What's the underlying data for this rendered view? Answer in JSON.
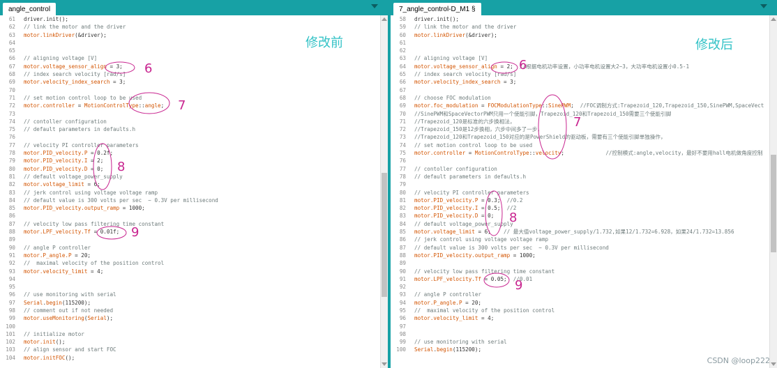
{
  "left": {
    "tab": "angle_control",
    "title": "修改前",
    "lines": [
      {
        "n": "61",
        "segs": [
          [
            "t",
            "driver.init();"
          ]
        ]
      },
      {
        "n": "62",
        "segs": [
          [
            "c",
            "// link the motor and the driver"
          ]
        ]
      },
      {
        "n": "63",
        "segs": [
          [
            "k",
            "motor.linkDriver"
          ],
          [
            "t",
            "(&driver);"
          ]
        ]
      },
      {
        "n": "64",
        "segs": []
      },
      {
        "n": "65",
        "segs": []
      },
      {
        "n": "66",
        "segs": [
          [
            "c",
            "// aligning voltage [V]"
          ]
        ]
      },
      {
        "n": "67",
        "segs": [
          [
            "k",
            "motor.voltage_sensor_align"
          ],
          [
            "t",
            " = 3;"
          ]
        ]
      },
      {
        "n": "68",
        "segs": [
          [
            "c",
            "// index search velocity [rad/s]"
          ]
        ]
      },
      {
        "n": "69",
        "segs": [
          [
            "k",
            "motor.velocity_index_search"
          ],
          [
            "t",
            " = 3;"
          ]
        ]
      },
      {
        "n": "70",
        "segs": []
      },
      {
        "n": "71",
        "segs": [
          [
            "c",
            "// set motion control loop to be used"
          ]
        ]
      },
      {
        "n": "72",
        "segs": [
          [
            "k",
            "motor.controller"
          ],
          [
            "t",
            " = "
          ],
          [
            "k",
            "MotionControlType"
          ],
          [
            "t",
            "::"
          ],
          [
            "k",
            "angle"
          ],
          [
            "t",
            ";"
          ]
        ]
      },
      {
        "n": "73",
        "segs": []
      },
      {
        "n": "74",
        "segs": [
          [
            "c",
            "// contoller configuration"
          ]
        ]
      },
      {
        "n": "75",
        "segs": [
          [
            "c",
            "// default parameters in defaults.h"
          ]
        ]
      },
      {
        "n": "76",
        "segs": []
      },
      {
        "n": "77",
        "segs": [
          [
            "c",
            "// velocity PI controller parameters"
          ]
        ]
      },
      {
        "n": "78",
        "segs": [
          [
            "k",
            "motor.PID_velocity.P"
          ],
          [
            "t",
            " = 0.2f;"
          ]
        ]
      },
      {
        "n": "79",
        "segs": [
          [
            "k",
            "motor.PID_velocity.I"
          ],
          [
            "t",
            " = 2;"
          ]
        ]
      },
      {
        "n": "80",
        "segs": [
          [
            "k",
            "motor.PID_velocity.D"
          ],
          [
            "t",
            " = 0;"
          ]
        ]
      },
      {
        "n": "81",
        "segs": [
          [
            "c",
            "// default voltage_power_supply"
          ]
        ]
      },
      {
        "n": "82",
        "segs": [
          [
            "k",
            "motor.voltage_limit"
          ],
          [
            "t",
            " = 6;"
          ]
        ]
      },
      {
        "n": "83",
        "segs": [
          [
            "c",
            "// jerk control using voltage voltage ramp"
          ]
        ]
      },
      {
        "n": "84",
        "segs": [
          [
            "c",
            "// default value is 300 volts per sec  ~ 0.3V per millisecond"
          ]
        ]
      },
      {
        "n": "85",
        "segs": [
          [
            "k",
            "motor.PID_velocity.output_ramp"
          ],
          [
            "t",
            " = 1000;"
          ]
        ]
      },
      {
        "n": "86",
        "segs": []
      },
      {
        "n": "87",
        "segs": [
          [
            "c",
            "// velocity low pass filtering time constant"
          ]
        ]
      },
      {
        "n": "88",
        "segs": [
          [
            "k",
            "motor.LPF_velocity.Tf"
          ],
          [
            "t",
            " = 0.01f;"
          ]
        ]
      },
      {
        "n": "89",
        "segs": []
      },
      {
        "n": "90",
        "segs": [
          [
            "c",
            "// angle P controller"
          ]
        ]
      },
      {
        "n": "91",
        "segs": [
          [
            "k",
            "motor.P_angle.P"
          ],
          [
            "t",
            " = 20;"
          ]
        ]
      },
      {
        "n": "92",
        "segs": [
          [
            "c",
            "//  maximal velocity of the position control"
          ]
        ]
      },
      {
        "n": "93",
        "segs": [
          [
            "k",
            "motor.velocity_limit"
          ],
          [
            "t",
            " = 4;"
          ]
        ]
      },
      {
        "n": "94",
        "segs": []
      },
      {
        "n": "95",
        "segs": []
      },
      {
        "n": "96",
        "segs": [
          [
            "c",
            "// use monitoring with serial"
          ]
        ]
      },
      {
        "n": "97",
        "segs": [
          [
            "k",
            "Serial"
          ],
          [
            "t",
            "."
          ],
          [
            "k",
            "begin"
          ],
          [
            "t",
            "(115200);"
          ]
        ]
      },
      {
        "n": "98",
        "segs": [
          [
            "c",
            "// comment out if not needed"
          ]
        ]
      },
      {
        "n": "99",
        "segs": [
          [
            "k",
            "motor.useMonitoring"
          ],
          [
            "t",
            "("
          ],
          [
            "k",
            "Serial"
          ],
          [
            "t",
            ");"
          ]
        ]
      },
      {
        "n": "100",
        "segs": []
      },
      {
        "n": "101",
        "segs": [
          [
            "c",
            "// initialize motor"
          ]
        ]
      },
      {
        "n": "102",
        "segs": [
          [
            "k",
            "motor.init"
          ],
          [
            "t",
            "();"
          ]
        ]
      },
      {
        "n": "103",
        "segs": [
          [
            "c",
            "// align sensor and start FOC"
          ]
        ]
      },
      {
        "n": "104",
        "segs": [
          [
            "k",
            "motor.initFOC"
          ],
          [
            "t",
            "();"
          ]
        ]
      }
    ],
    "markers": [
      "6",
      "7",
      "8",
      "9"
    ]
  },
  "right": {
    "tab": "7_angle_control-D_M1 §",
    "title": "修改后",
    "lines": [
      {
        "n": "58",
        "segs": [
          [
            "t",
            "driver.init();"
          ]
        ]
      },
      {
        "n": "59",
        "segs": [
          [
            "c",
            "// link the motor and the driver"
          ]
        ]
      },
      {
        "n": "60",
        "segs": [
          [
            "k",
            "motor.linkDriver"
          ],
          [
            "t",
            "(&driver);"
          ]
        ]
      },
      {
        "n": "61",
        "segs": []
      },
      {
        "n": "62",
        "segs": []
      },
      {
        "n": "63",
        "segs": [
          [
            "c",
            "// aligning voltage [V]"
          ]
        ]
      },
      {
        "n": "64",
        "segs": [
          [
            "k",
            "motor.voltage_sensor_align"
          ],
          [
            "t",
            " = 2;  "
          ],
          [
            "c",
            "//根据电机功率设置，小功率电机设置大2~3，大功率电机设置小0.5-1"
          ]
        ]
      },
      {
        "n": "65",
        "segs": [
          [
            "c",
            "// index search velocity [rad/s]"
          ]
        ]
      },
      {
        "n": "66",
        "segs": [
          [
            "k",
            "motor.velocity_index_search"
          ],
          [
            "t",
            " = 3;"
          ]
        ]
      },
      {
        "n": "67",
        "segs": []
      },
      {
        "n": "68",
        "segs": [
          [
            "c",
            "// choose FOC modulation"
          ]
        ]
      },
      {
        "n": "69",
        "segs": [
          [
            "k",
            "motor.foc_modulation"
          ],
          [
            "t",
            " = "
          ],
          [
            "k",
            "FOCModulationType"
          ],
          [
            "t",
            "::"
          ],
          [
            "k",
            "SinePWM"
          ],
          [
            "t",
            ";  "
          ],
          [
            "c",
            "//FOC调制方式:Trapezoid_120,Trapezoid_150,SinePWM,SpaceVect"
          ]
        ]
      },
      {
        "n": "70",
        "segs": [
          [
            "c",
            "//SinePWM和SpaceVectorPWM只用一个使能引脚，Trapezoid_120和Trapezoid_150需要三个使能引脚"
          ]
        ]
      },
      {
        "n": "71",
        "segs": [
          [
            "c",
            "//Trapezoid_120是标准的六步换相法，"
          ]
        ]
      },
      {
        "n": "72",
        "segs": [
          [
            "c",
            "//Trapezoid_150是12步换相，六步中间多了一步，"
          ]
        ]
      },
      {
        "n": "73",
        "segs": [
          [
            "c",
            "//Trapezoid_120和Trapezoid_150对应的是PowerShield的驱动板，需要有三个使能引脚单独操作，"
          ]
        ]
      },
      {
        "n": "74",
        "segs": [
          [
            "c",
            "// set motion control loop to be used"
          ]
        ]
      },
      {
        "n": "75",
        "segs": [
          [
            "k",
            "motor.controller"
          ],
          [
            "t",
            " = "
          ],
          [
            "k",
            "MotionControlType"
          ],
          [
            "t",
            "::"
          ],
          [
            "k",
            "velocity"
          ],
          [
            "t",
            ";             "
          ],
          [
            "c",
            "//控制模式:angle,velocity，最好不要用hall电机做角度控制"
          ]
        ]
      },
      {
        "n": "76",
        "segs": []
      },
      {
        "n": "77",
        "segs": [
          [
            "c",
            "// contoller configuration"
          ]
        ]
      },
      {
        "n": "78",
        "segs": [
          [
            "c",
            "// default parameters in defaults.h"
          ]
        ]
      },
      {
        "n": "79",
        "segs": []
      },
      {
        "n": "80",
        "segs": [
          [
            "c",
            "// velocity PI controller parameters"
          ]
        ]
      },
      {
        "n": "81",
        "segs": [
          [
            "k",
            "motor.PID_velocity.P"
          ],
          [
            "t",
            " = 0.3;  "
          ],
          [
            "c",
            "//0.2"
          ]
        ]
      },
      {
        "n": "82",
        "segs": [
          [
            "k",
            "motor.PID_velocity.I"
          ],
          [
            "t",
            " = 0.5;  "
          ],
          [
            "c",
            "//2"
          ]
        ]
      },
      {
        "n": "83",
        "segs": [
          [
            "k",
            "motor.PID_velocity.D"
          ],
          [
            "t",
            " = 0;"
          ]
        ]
      },
      {
        "n": "84",
        "segs": [
          [
            "c",
            "// default voltage_power_supply"
          ]
        ]
      },
      {
        "n": "85",
        "segs": [
          [
            "k",
            "motor.voltage_limit"
          ],
          [
            "t",
            " = 6;    "
          ],
          [
            "c",
            "// 最大值voltage_power_supply/1.732,如果12/1.732=6.928，如果24/1.732=13.856"
          ]
        ]
      },
      {
        "n": "86",
        "segs": [
          [
            "c",
            "// jerk control using voltage voltage ramp"
          ]
        ]
      },
      {
        "n": "87",
        "segs": [
          [
            "c",
            "// default value is 300 volts per sec  ~ 0.3V per millisecond"
          ]
        ]
      },
      {
        "n": "88",
        "segs": [
          [
            "k",
            "motor.PID_velocity.output_ramp"
          ],
          [
            "t",
            " = 1000;"
          ]
        ]
      },
      {
        "n": "89",
        "segs": []
      },
      {
        "n": "90",
        "segs": [
          [
            "c",
            "// velocity low pass filtering time constant"
          ]
        ]
      },
      {
        "n": "91",
        "segs": [
          [
            "k",
            "motor.LPF_velocity.Tf"
          ],
          [
            "t",
            " = 0.05;  "
          ],
          [
            "c",
            "//0.01"
          ]
        ]
      },
      {
        "n": "92",
        "segs": []
      },
      {
        "n": "93",
        "segs": [
          [
            "c",
            "// angle P controller"
          ]
        ]
      },
      {
        "n": "94",
        "segs": [
          [
            "k",
            "motor.P_angle.P"
          ],
          [
            "t",
            " = 20;"
          ]
        ]
      },
      {
        "n": "95",
        "segs": [
          [
            "c",
            "//  maximal velocity of the position control"
          ]
        ]
      },
      {
        "n": "96",
        "segs": [
          [
            "k",
            "motor.velocity_limit"
          ],
          [
            "t",
            " = 4;"
          ]
        ]
      },
      {
        "n": "97",
        "segs": []
      },
      {
        "n": "98",
        "segs": []
      },
      {
        "n": "99",
        "segs": [
          [
            "c",
            "// use monitoring with serial"
          ]
        ]
      },
      {
        "n": "100",
        "segs": [
          [
            "k",
            "Serial"
          ],
          [
            "t",
            "."
          ],
          [
            "k",
            "begin"
          ],
          [
            "t",
            "(115200);"
          ]
        ]
      }
    ],
    "markers": [
      "6",
      "7",
      "8",
      "9"
    ]
  },
  "watermark": "CSDN @loop222",
  "colors": {
    "teal": "#17a1a5",
    "keyword": "#d35400",
    "comment": "#6e7b7b",
    "annotation": "#c8248f",
    "title": "#32c2c6"
  }
}
